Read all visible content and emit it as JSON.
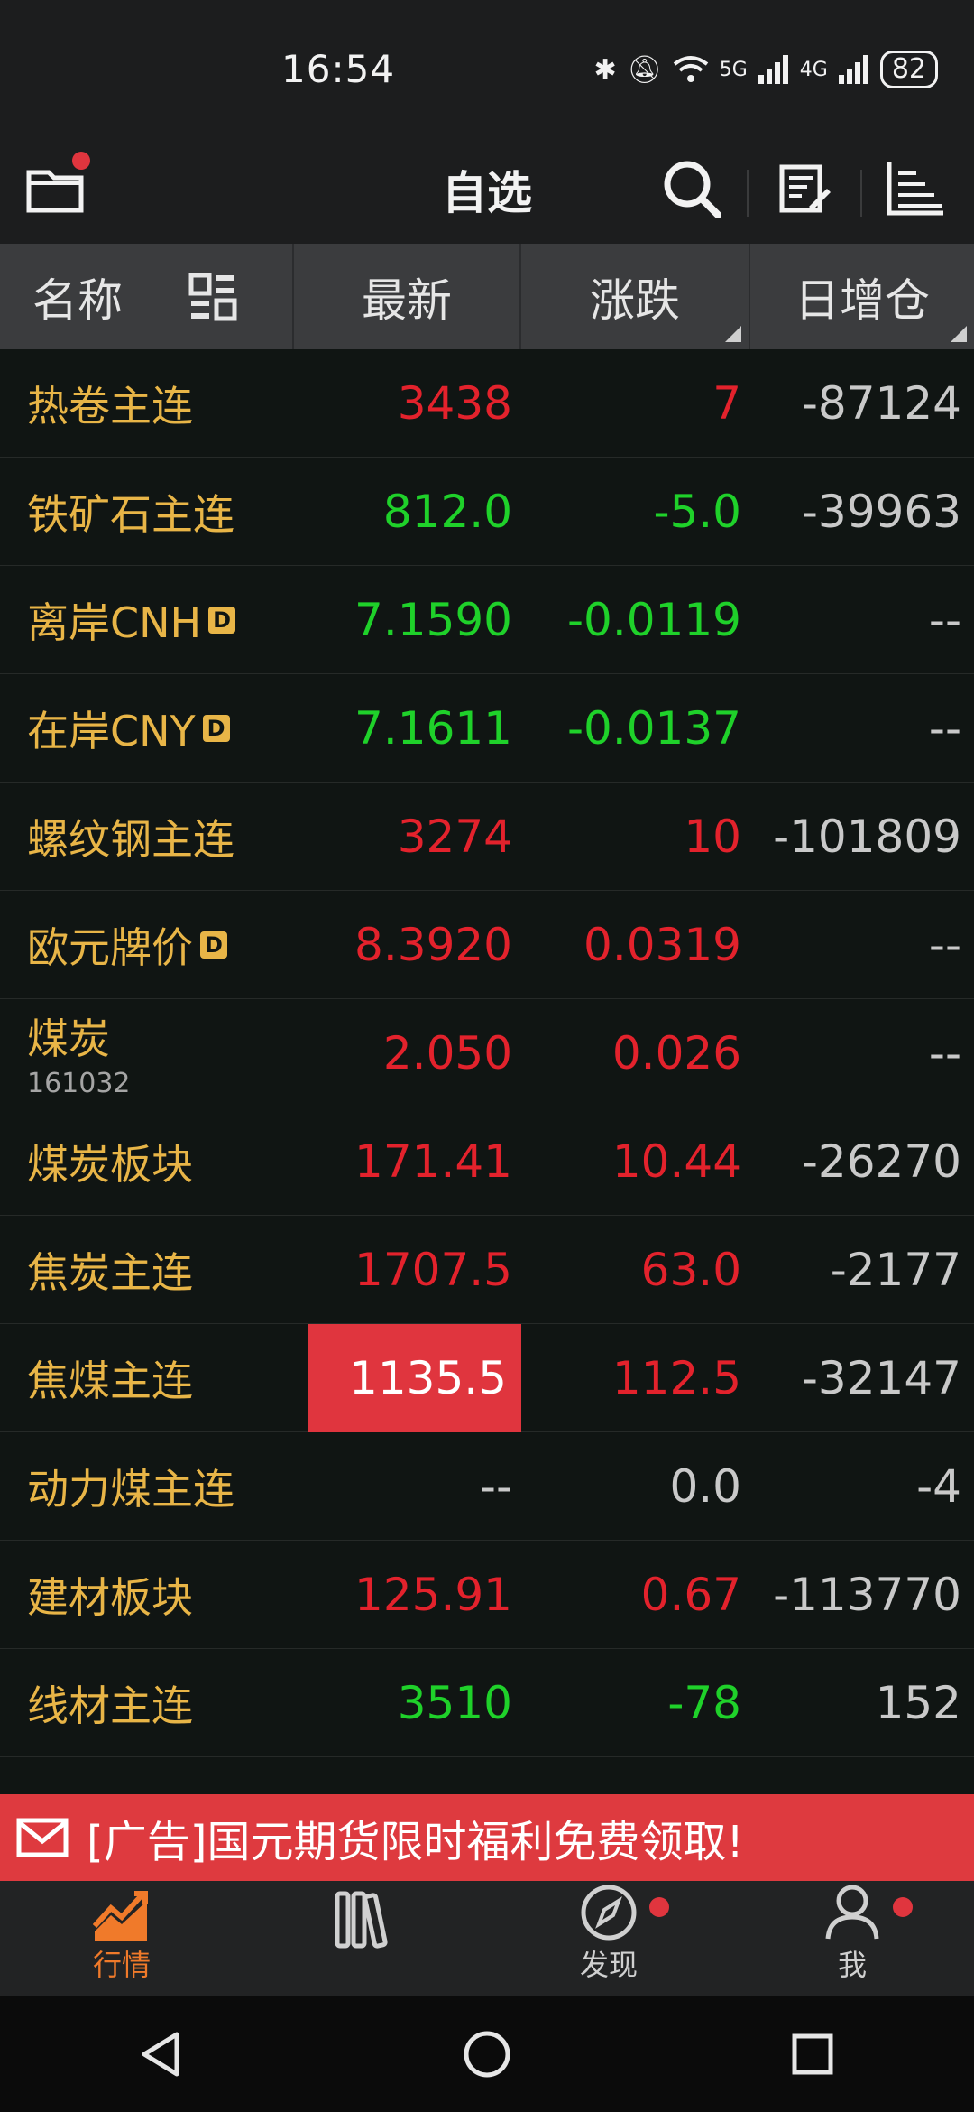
{
  "status": {
    "time": "16:54",
    "battery": "82",
    "net1": "5G",
    "net2": "4G"
  },
  "appbar": {
    "title": "自选"
  },
  "header": {
    "name": "名称",
    "latest": "最新",
    "change": "涨跌",
    "oi_change": "日增仓"
  },
  "rows": [
    {
      "name": "热卷主连",
      "latest": "3438",
      "change": "7",
      "oi": "-87124"
    },
    {
      "name": "铁矿石主连",
      "latest": "812.0",
      "change": "-5.0",
      "oi": "-39963"
    },
    {
      "name": "离岸CNH",
      "badge": "D",
      "latest": "7.1590",
      "change": "-0.0119",
      "oi": "--"
    },
    {
      "name": "在岸CNY",
      "badge": "D",
      "latest": "7.1611",
      "change": "-0.0137",
      "oi": "--"
    },
    {
      "name": "螺纹钢主连",
      "latest": "3274",
      "change": "10",
      "oi": "-101809"
    },
    {
      "name": "欧元牌价",
      "badge": "D",
      "latest": "8.3920",
      "change": "0.0319",
      "oi": "--"
    },
    {
      "name": "煤炭",
      "code": "161032",
      "latest": "2.050",
      "change": "0.026",
      "oi": "--"
    },
    {
      "name": "煤炭板块",
      "latest": "171.41",
      "change": "10.44",
      "oi": "-26270"
    },
    {
      "name": "焦炭主连",
      "latest": "1707.5",
      "change": "63.0",
      "oi": "-2177"
    },
    {
      "name": "焦煤主连",
      "latest": "1135.5",
      "change": "112.5",
      "oi": "-32147"
    },
    {
      "name": "动力煤主连",
      "latest": "--",
      "change": "0.0",
      "oi": "-4"
    },
    {
      "name": "建材板块",
      "latest": "125.91",
      "change": "0.67",
      "oi": "-113770"
    },
    {
      "name": "线材主连",
      "latest": "3510",
      "change": "-78",
      "oi": "152"
    }
  ],
  "ad": {
    "text": "[广告]国元期货限时福利免费领取!"
  },
  "tabs": {
    "market": "行情",
    "discover": "发现",
    "me": "我"
  },
  "colors": {
    "up": "#e3222c",
    "down": "#1fd12a",
    "accent": "#f07a2a",
    "name": "#e8b547"
  }
}
